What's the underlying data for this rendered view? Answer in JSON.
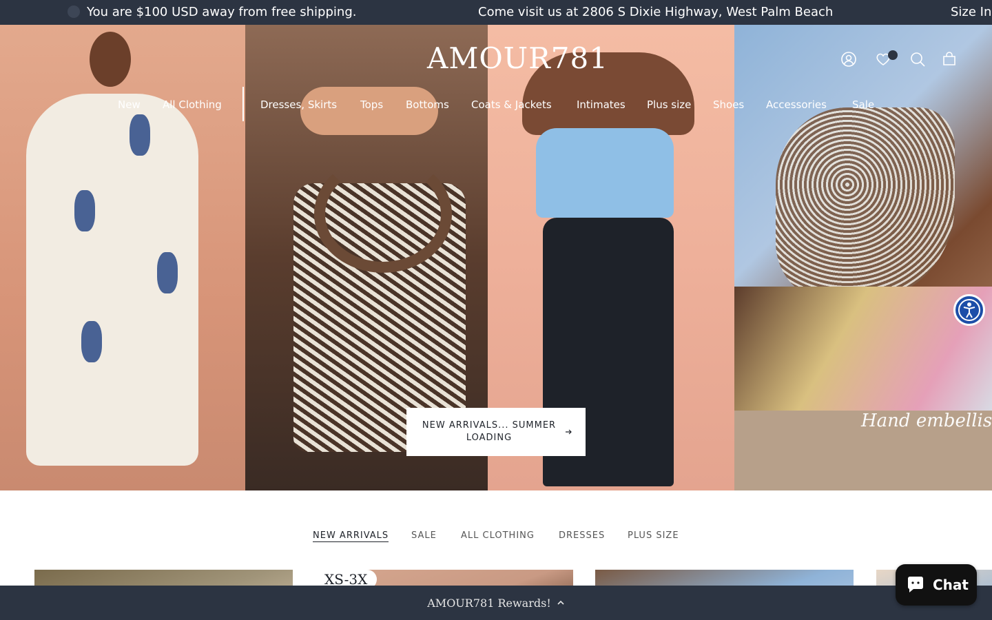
{
  "announcement": {
    "messages": [
      "You are $100 USD away from free shipping.",
      "Come visit us at 2806 S Dixie Highway, West Palm Beach",
      "Size Inc"
    ]
  },
  "header": {
    "logo": "AMOUR781",
    "icons": [
      "account-icon",
      "wishlist-icon",
      "search-icon",
      "cart-icon"
    ]
  },
  "nav": {
    "items": [
      "New",
      "All Clothing",
      "Dresses, Skirts",
      "Tops",
      "Bottoms",
      "Coats & Jackets",
      "Intimates",
      "Plus size",
      "Shoes",
      "Accessories",
      "Sale"
    ]
  },
  "hero": {
    "cta_label": "NEW ARRIVALS... SUMMER LOADING",
    "overlay_text": "Hand embellished"
  },
  "collections": {
    "tabs": [
      "NEW ARRIVALS",
      "SALE",
      "ALL CLOTHING",
      "DRESSES",
      "PLUS SIZE"
    ],
    "active_tab": "NEW ARRIVALS"
  },
  "products": {
    "badge": "XS-3X"
  },
  "rewards": {
    "label": "AMOUR781 Rewards!"
  },
  "chat": {
    "label": "Chat"
  },
  "colors": {
    "bar_bg": "#2c3442",
    "accessibility_blue": "#1c4ea8",
    "chat_bg": "#111111"
  }
}
